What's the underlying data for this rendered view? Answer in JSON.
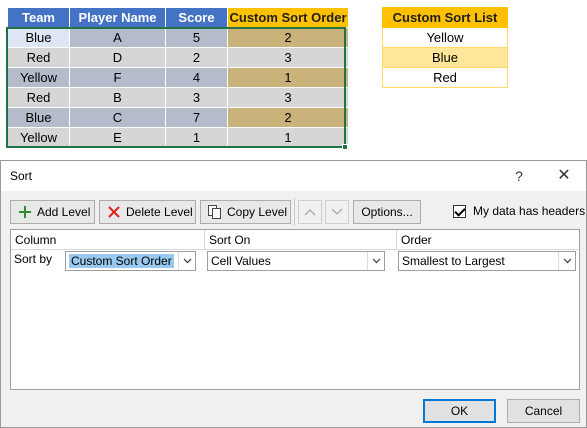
{
  "grid": {
    "headers": [
      "Team",
      "Player Name",
      "Score",
      "Custom Sort Order"
    ],
    "rows": [
      [
        "Blue",
        "A",
        "5",
        "2"
      ],
      [
        "Red",
        "D",
        "2",
        "3"
      ],
      [
        "Yellow",
        "F",
        "4",
        "1"
      ],
      [
        "Red",
        "B",
        "3",
        "3"
      ],
      [
        "Blue",
        "C",
        "7",
        "2"
      ],
      [
        "Yellow",
        "E",
        "1",
        "1"
      ]
    ]
  },
  "custom_list": {
    "header": "Custom Sort List",
    "items": [
      "Yellow",
      "Blue",
      "Red"
    ]
  },
  "dialog": {
    "title": "Sort",
    "help": "?",
    "close": "✕",
    "toolbar": {
      "add_level": "Add Level",
      "delete_level": "Delete Level",
      "copy_level": "Copy Level",
      "options": "Options..."
    },
    "my_data_has_headers": "My data has headers",
    "headers_checked": true,
    "columns": {
      "column": "Column",
      "sort_on": "Sort On",
      "order": "Order"
    },
    "level": {
      "label": "Sort by",
      "column": "Custom Sort Order",
      "sort_on": "Cell Values",
      "order": "Smallest to Largest"
    },
    "ok": "OK",
    "cancel": "Cancel"
  }
}
